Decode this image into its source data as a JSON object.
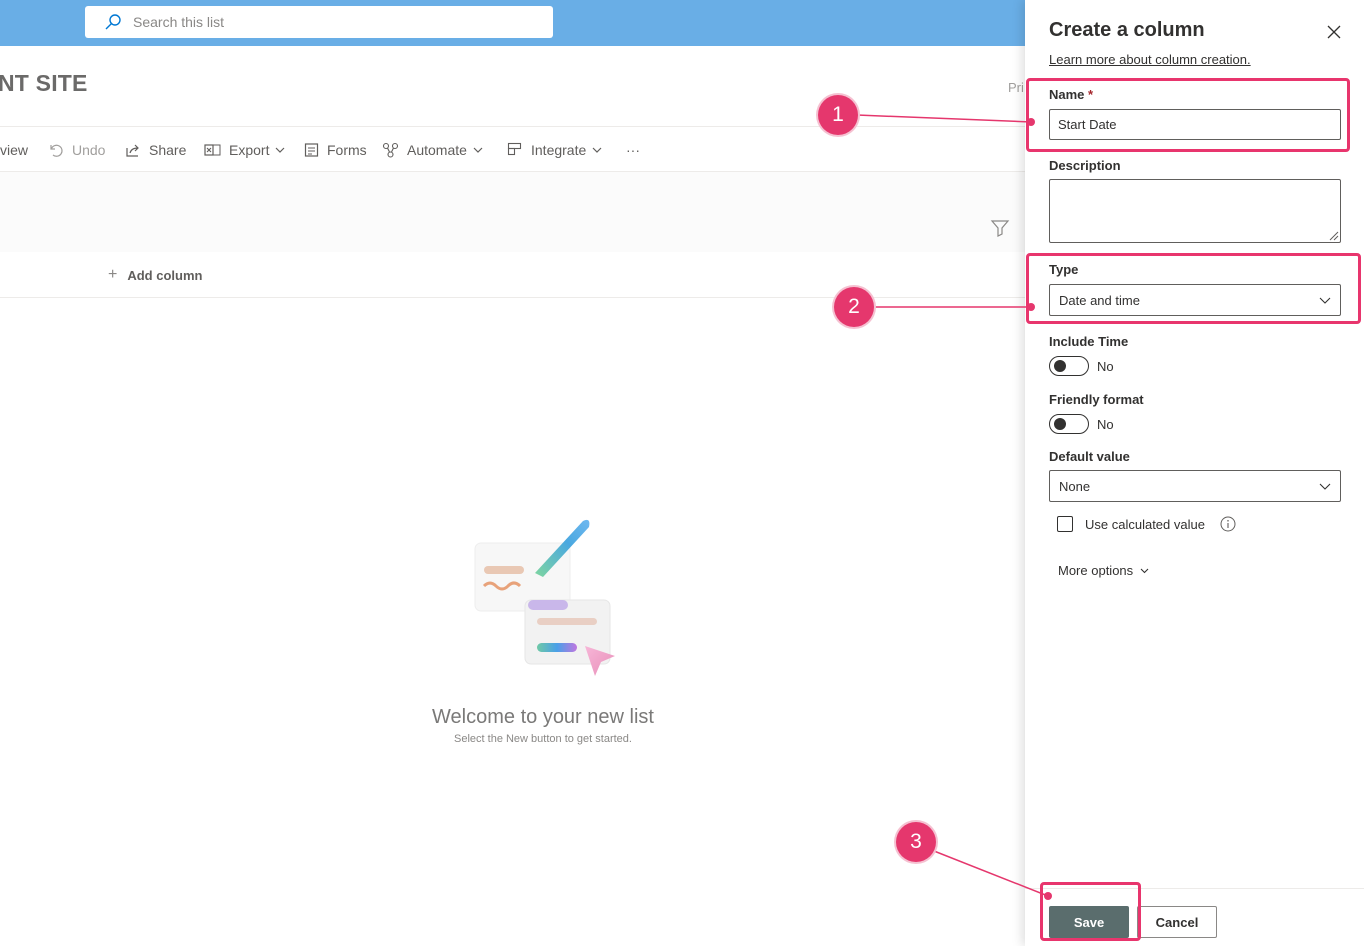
{
  "search": {
    "placeholder": "Search this list"
  },
  "site": {
    "title_fragment": "NT SITE",
    "pri_fragment": "Pri"
  },
  "command_bar": {
    "view_fragment": "view",
    "undo": "Undo",
    "share": "Share",
    "export": "Export",
    "forms": "Forms",
    "automate": "Automate",
    "integrate": "Integrate",
    "more": "···"
  },
  "list": {
    "add_column": "Add column",
    "welcome_title": "Welcome to your new list",
    "welcome_sub": "Select the New button to get started."
  },
  "panel": {
    "title": "Create a column",
    "learn_more": "Learn more about column creation.",
    "name_label": "Name",
    "required_mark": "*",
    "name_value": "Start Date",
    "description_label": "Description",
    "description_value": "",
    "type_label": "Type",
    "type_value": "Date and time",
    "include_time_label": "Include Time",
    "include_time_value": "No",
    "friendly_format_label": "Friendly format",
    "friendly_format_value": "No",
    "default_value_label": "Default value",
    "default_value_value": "None",
    "use_calculated_label": "Use calculated value",
    "more_options": "More options",
    "save_label": "Save",
    "cancel_label": "Cancel"
  },
  "annotations": {
    "step1": "1",
    "step2": "2",
    "step3": "3",
    "accent_color": "#e5376d"
  }
}
